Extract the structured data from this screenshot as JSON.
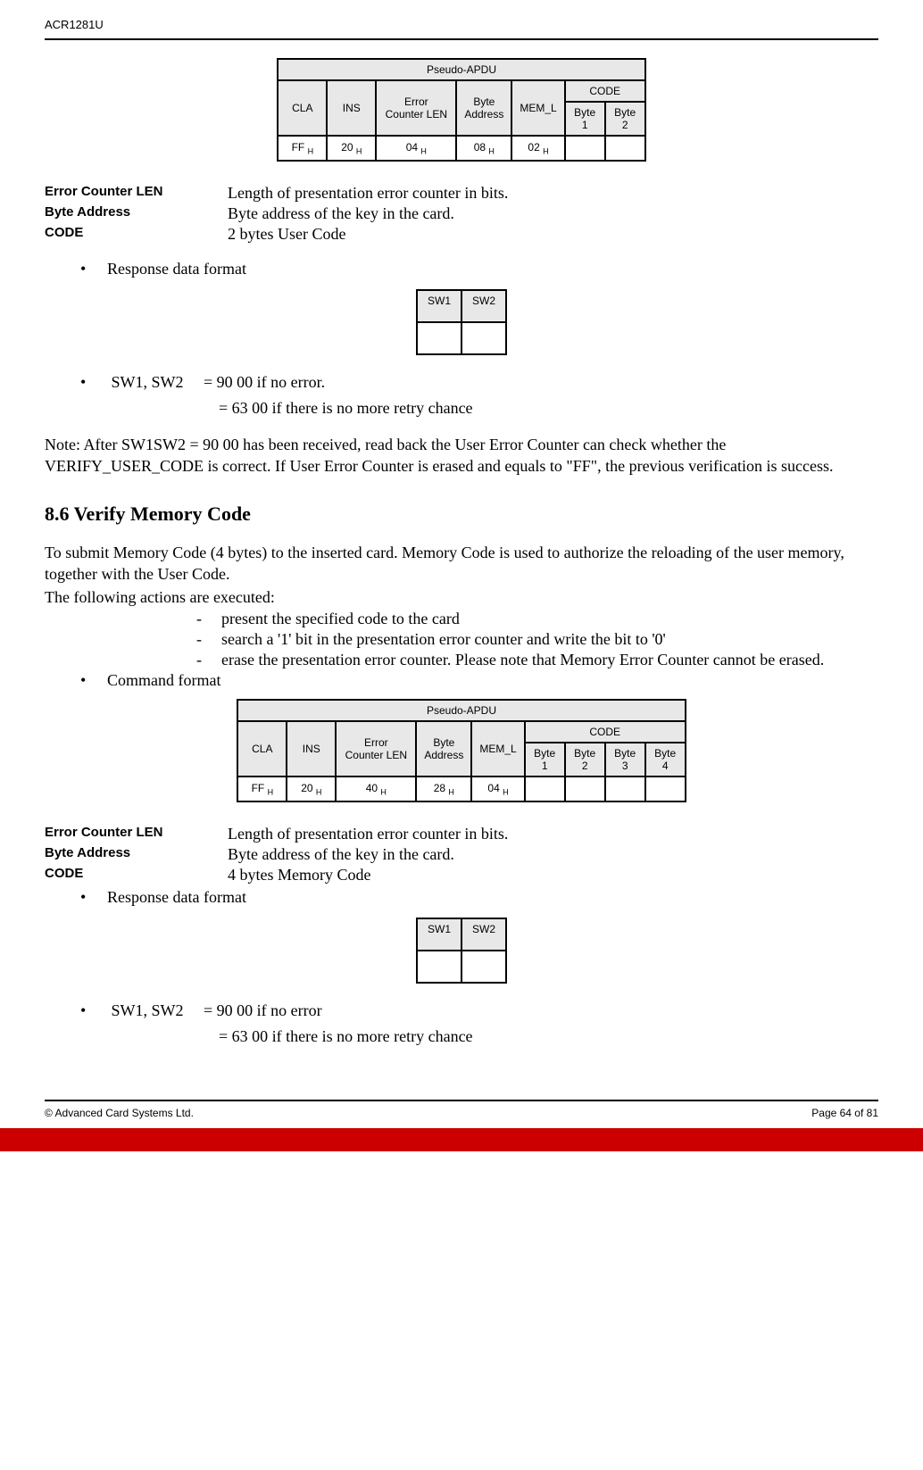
{
  "header": {
    "title": "ACR1281U"
  },
  "table1": {
    "title": "Pseudo-APDU",
    "headers": {
      "cla": "CLA",
      "ins": "INS",
      "ecl": "Error Counter LEN",
      "ba": "Byte Address",
      "meml": "MEM_L",
      "code": "CODE",
      "b1": "Byte 1",
      "b2": "Byte 2"
    },
    "row": {
      "cla": "FF ",
      "ins": "20 ",
      "ecl": "04 ",
      "ba": "08 ",
      "meml": "02 ",
      "sub": "H"
    }
  },
  "defs1": {
    "ecl_label": "Error Counter LEN",
    "ecl_value": "Length of presentation error counter in bits.",
    "ba_label": "Byte Address",
    "ba_value": "Byte address of the key in the card.",
    "code_label": "CODE",
    "code_value": "2 bytes User Code"
  },
  "bullets1": {
    "resp": "Response data format"
  },
  "resp_table": {
    "sw1": "SW1",
    "sw2": "SW2"
  },
  "sw_text": {
    "line1a": "SW1, SW2",
    "line1b": "= 90 00 if no error.",
    "line2": "= 63 00 if there is no more retry chance"
  },
  "note1": "Note:  After SW1SW2 = 90 00 has been received, read back the User Error Counter can check whether the VERIFY_USER_CODE is correct.  If User Error Counter is erased and equals to \"FF\", the previous verification is success.",
  "section": {
    "title": "8.6 Verify Memory Code"
  },
  "para1": "To submit Memory Code (4 bytes) to the inserted card.  Memory Code is used to authorize the reloading of the user memory, together with the User Code.",
  "para2": "The following actions are executed:",
  "dashes": {
    "d1": "present the specified code to the card",
    "d2": "search a '1' bit in the presentation error counter and write the bit to '0'",
    "d3": "erase the presentation error counter.  Please note that Memory Error Counter cannot be erased."
  },
  "bullets2": {
    "cmd": "Command format"
  },
  "table2": {
    "title": "Pseudo-APDU",
    "headers": {
      "cla": "CLA",
      "ins": "INS",
      "ecl": "Error Counter LEN",
      "ba": "Byte Address",
      "meml": "MEM_L",
      "code": "CODE",
      "b1": "Byte 1",
      "b2": "Byte 2",
      "b3": "Byte 3",
      "b4": "Byte 4"
    },
    "row": {
      "cla": "FF ",
      "ins": "20 ",
      "ecl": "40 ",
      "ba": "28 ",
      "meml": "04 ",
      "sub": "H"
    }
  },
  "defs2": {
    "ecl_label": "Error Counter LEN",
    "ecl_value": "Length of presentation error counter in bits.",
    "ba_label": "Byte Address",
    "ba_value": "Byte address of the key in the card.",
    "code_label": "CODE",
    "code_value": "4 bytes Memory Code"
  },
  "bullets3": {
    "resp": "Response data format"
  },
  "sw_text2": {
    "line1a": "SW1, SW2",
    "line1b": "= 90 00 if no error",
    "line2": "= 63 00 if there is no more retry chance"
  },
  "footer": {
    "left": "© Advanced Card Systems Ltd.",
    "right": "Page 64 of 81"
  }
}
